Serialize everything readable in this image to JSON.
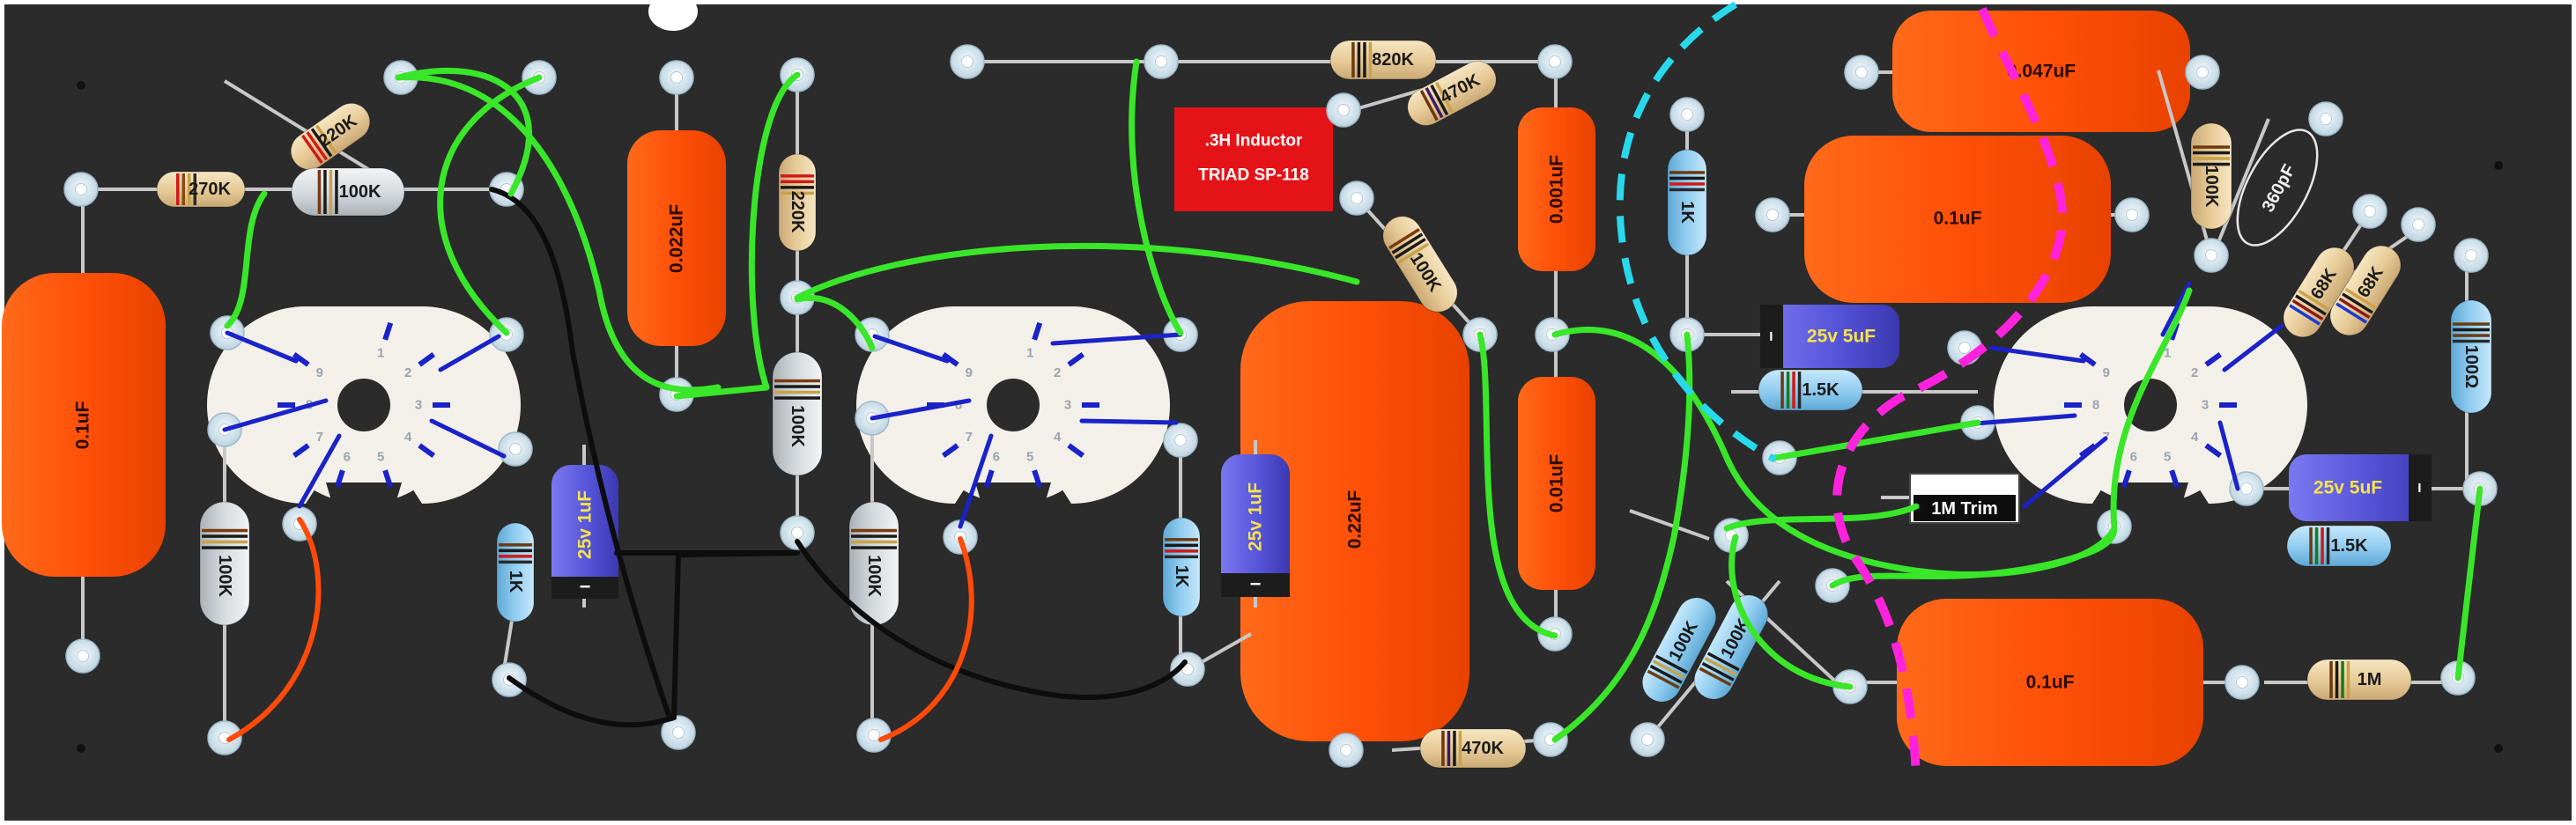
{
  "colors": {
    "board": "#2b2b2b",
    "eyelet": "#d7e6ef",
    "film_cap": "#ff5008",
    "res_tan": "#ecd4a2",
    "res_grey": "#d6dade",
    "res_blue": "#8ecbef",
    "elec_cap": "#5654d9",
    "wire_green": "#39e629",
    "wire_black": "#0d0d0d",
    "wire_orange": "#ff4a0a",
    "dash_cyan": "#28d9ec",
    "dash_magenta": "#ff22dd",
    "heater_blue": "#1a22c8"
  },
  "inductor": {
    "line1": ".3H Inductor",
    "line2": "TRIAD SP-118"
  },
  "trim": {
    "label": "1M Trim"
  },
  "resistors": {
    "r1": "270K",
    "r2": "220K",
    "r3": "100K",
    "r4": "100K",
    "r5": "1K",
    "r6": "220K",
    "r7": "100K",
    "r8": "100K",
    "r9": "820K",
    "r10": "470K",
    "r11": "1K",
    "r12": "100K",
    "r13": "470K",
    "r14": "1K",
    "r15": "1.5K",
    "r16": "100K",
    "r17": "100K",
    "r18": "100K",
    "r19": "68K",
    "r20": "68K",
    "r21": "100Ω",
    "r22": "1.5K",
    "r23": "1M"
  },
  "caps": {
    "c1": "0.1uF",
    "c2": "0.022uF",
    "c3": "0.22uF",
    "c4": "0.001uF",
    "c5": "0.01uF",
    "c6": "0.047uF",
    "c7": "0.1uF",
    "c8": "0.1uF",
    "c9": "360pF"
  },
  "electrolytics": {
    "e1": {
      "label": "25v 1uF",
      "mark": "−"
    },
    "e2": {
      "label": "25v 1uF",
      "mark": "−"
    },
    "e3": {
      "label": "25v 5uF",
      "mark": "−"
    },
    "e4": {
      "label": "25v 5uF",
      "mark": "−"
    }
  },
  "tube_pins": [
    "1",
    "2",
    "3",
    "4",
    "5",
    "6",
    "7",
    "8",
    "9"
  ]
}
